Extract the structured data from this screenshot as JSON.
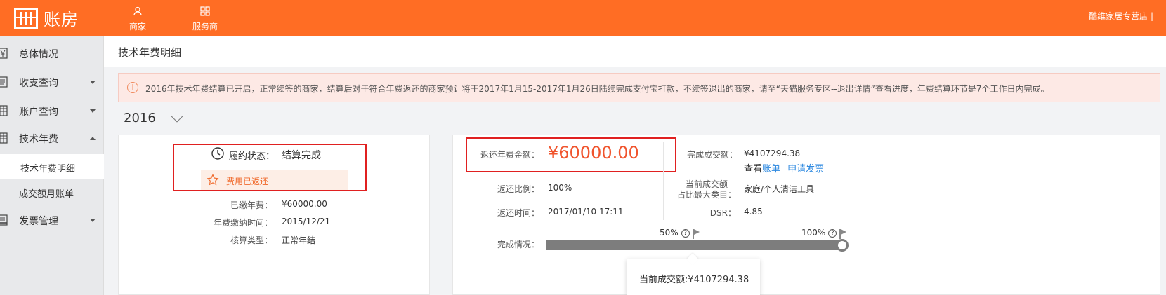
{
  "topbar": {
    "logo_text": "账房",
    "nav": [
      {
        "label": "商家",
        "icon": "user-icon"
      },
      {
        "label": "服务商",
        "icon": "grid-icon"
      }
    ],
    "store_name": "酷维家居专营店 |",
    "bg_color": "#ff6d24"
  },
  "sidebar": {
    "items": [
      {
        "label": "总体情况",
        "icon": "yen-icon"
      },
      {
        "label": "收支查询",
        "icon": "ledger-icon"
      },
      {
        "label": "账户查询",
        "icon": "table-icon"
      },
      {
        "label": "技术年费",
        "icon": "table-icon"
      },
      {
        "label": "发票管理",
        "icon": "invoice-icon"
      }
    ],
    "sub_items": [
      {
        "label": "技术年费明细"
      },
      {
        "label": "成交额月账单"
      }
    ]
  },
  "page": {
    "title": "技术年费明细",
    "notice": "2016年技术年费结算已开启，正常续签的商家，结算后对于符合年费返还的商家预计将于2017年1月15-2017年1月26日陆续完成支付宝打款，不续签退出的商家，请至“天猫服务专区--退出详情”查看进度，年费结算环节是7个工作日内完成。",
    "notice_icon": "i",
    "year": "2016"
  },
  "left_card": {
    "status_key": "履约状态：",
    "status_value": "结算完成",
    "refund_tag": "费用已返还",
    "rows": [
      {
        "key": "已缴年费：",
        "value": "¥60000.00"
      },
      {
        "key": "年费缴纳时间：",
        "value": "2015/12/21"
      },
      {
        "key": "核算类型：",
        "value": "正常年结"
      }
    ]
  },
  "right_card": {
    "refund_amount_key": "返还年费金额：",
    "refund_amount": "¥60000.00",
    "refund_ratio_key": "返还比例：",
    "refund_ratio": "100%",
    "refund_time_key": "返还时间：",
    "refund_time": "2017/01/10 17:11",
    "completed_key": "完成成交额：",
    "completed_value": "¥4107294.38",
    "view_prefix": "查看",
    "bill_link": "账单",
    "invoice_link": "申请发票",
    "category_key_line1": "当前成交额",
    "category_key_line2": "占比最大类目：",
    "category_value": "家庭/个人清洁工具",
    "dsr_key": "DSR：",
    "dsr_value": "4.85",
    "progress_key": "完成情况：",
    "marker_50": "50%",
    "marker_100": "100%",
    "q_mark": "?",
    "progress_fraction": 1.0,
    "tooltip": "当前成交额:¥4107294.38"
  }
}
